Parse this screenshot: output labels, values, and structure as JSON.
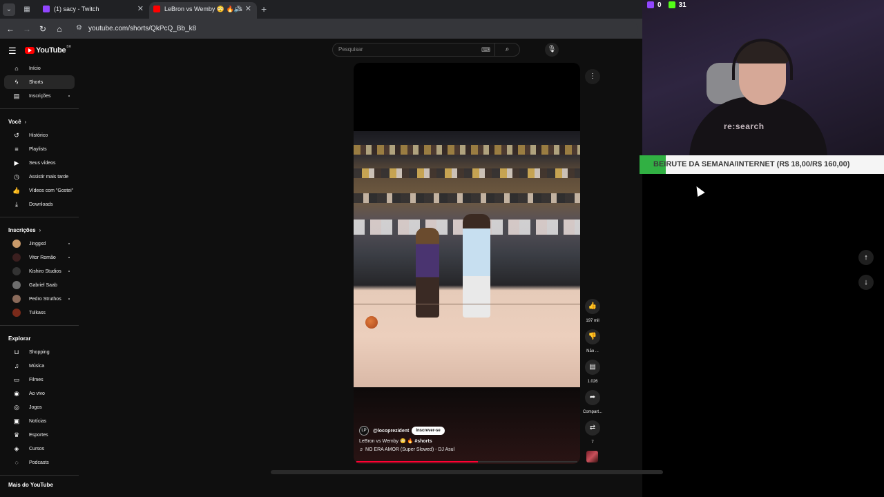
{
  "browser": {
    "tabs": [
      {
        "label": "(1) sacy - Twitch",
        "favicon_color": "#9146ff",
        "active": false
      },
      {
        "label": "LeBron vs Wemby 😳 🔥 #s",
        "favicon_color": "#ff0000",
        "active": true
      }
    ],
    "url": "youtube.com/shorts/QkPcQ_Bb_k8"
  },
  "youtube": {
    "logo_text": "YouTube",
    "logo_region": "BR",
    "search": {
      "placeholder": "Pesquisar"
    },
    "sidebar": {
      "main": [
        {
          "label": "Início",
          "icon": "home-icon",
          "active": false
        },
        {
          "label": "Shorts",
          "icon": "shorts-icon",
          "active": true
        },
        {
          "label": "Inscrições",
          "icon": "subscriptions-icon",
          "active": false
        }
      ],
      "you_header": "Você",
      "you": [
        {
          "label": "Histórico",
          "icon": "history-icon"
        },
        {
          "label": "Playlists",
          "icon": "playlists-icon"
        },
        {
          "label": "Seus vídeos",
          "icon": "your-videos-icon"
        },
        {
          "label": "Assistir mais tarde",
          "icon": "watch-later-icon"
        },
        {
          "label": "Vídeos com \"Gostei\"",
          "icon": "liked-icon"
        },
        {
          "label": "Downloads",
          "icon": "download-icon"
        }
      ],
      "subs_header": "Inscrições",
      "subscriptions": [
        {
          "label": "Jinggxd",
          "color": "#c99a6a"
        },
        {
          "label": "Vitor Romão",
          "color": "#3b1f1f"
        },
        {
          "label": "Kishiro Studios",
          "color": "#333333"
        },
        {
          "label": "Gabriel Saab",
          "color": "#6d6d6d"
        },
        {
          "label": "Pedro Struthos",
          "color": "#8a6a5a"
        },
        {
          "label": "Tulkass",
          "color": "#7a2a1a"
        }
      ],
      "explore_header": "Explorar",
      "explore": [
        {
          "label": "Shopping",
          "icon": "shopping-bag-icon"
        },
        {
          "label": "Música",
          "icon": "music-note-icon"
        },
        {
          "label": "Filmes",
          "icon": "film-icon"
        },
        {
          "label": "Ao vivo",
          "icon": "live-icon"
        },
        {
          "label": "Jogos",
          "icon": "gamepad-icon"
        },
        {
          "label": "Notícias",
          "icon": "news-icon"
        },
        {
          "label": "Esportes",
          "icon": "trophy-icon"
        },
        {
          "label": "Cursos",
          "icon": "courses-icon"
        },
        {
          "label": "Podcasts",
          "icon": "podcast-icon"
        }
      ],
      "more_header": "Mais do YouTube"
    },
    "short": {
      "channel": "@locoprezident",
      "subscribe_label": "Inscrever-se",
      "title": "LeBron vs Wemby 😳 🔥",
      "hashtag": "#shorts",
      "music": "NO ERA AMOR (Super Slowed) - DJ Asul",
      "progress": 0.55,
      "actions": {
        "likes": "197 mil",
        "dislike_label": "Não ...",
        "comments": "1.026",
        "share_label": "Compart...",
        "remix_count": "7"
      }
    }
  },
  "overlay": {
    "stats": [
      {
        "value": "0",
        "color": "#9146ff",
        "icon": "twitch-viewers-icon"
      },
      {
        "value": "31",
        "color": "#53fc18",
        "icon": "kick-viewers-icon"
      }
    ],
    "shirt_text": "re:search",
    "banner_text": "BEIRUTE DA SEMANA/INTERNET (R$ 18,00/R$ 160,00)"
  }
}
